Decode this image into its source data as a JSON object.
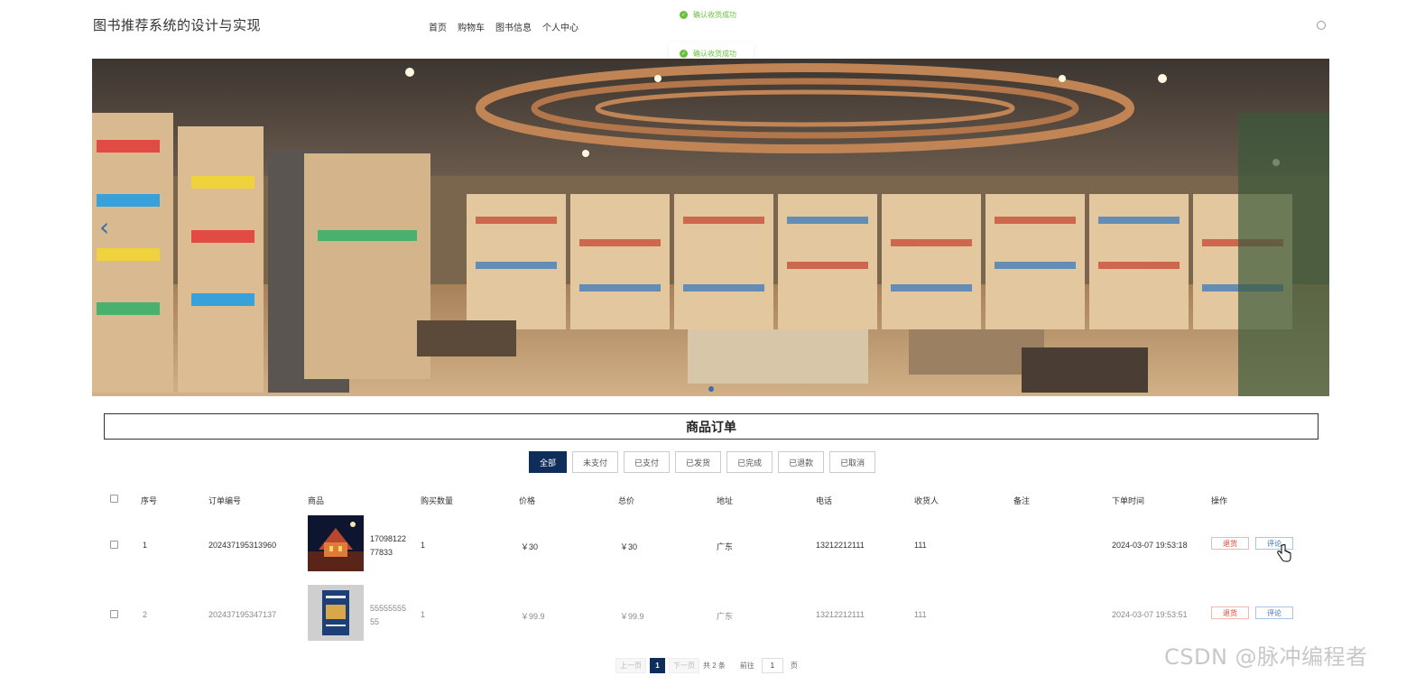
{
  "header": {
    "site_title": "图书推荐系统的设计与实现",
    "nav": [
      "首页",
      "购物车",
      "图书信息",
      "个人中心"
    ]
  },
  "toasts": [
    "确认收货成功",
    "确认收货成功"
  ],
  "section": {
    "title": "商品订单"
  },
  "filters": {
    "tabs": [
      "全部",
      "未支付",
      "已支付",
      "已发货",
      "已完成",
      "已退款",
      "已取消"
    ],
    "active": "全部"
  },
  "table": {
    "columns": [
      "序号",
      "订单编号",
      "商品",
      "购买数量",
      "价格",
      "总价",
      "地址",
      "电话",
      "收货人",
      "备注",
      "下单时间",
      "操作"
    ],
    "rows": [
      {
        "index": "1",
        "order_no": "202437195313960",
        "goods_id_line1": "17098122",
        "goods_id_line2": "77833",
        "qty": "1",
        "price": "￥30",
        "total": "￥30",
        "address": "广东",
        "phone": "13212212111",
        "receiver": "111",
        "note": "",
        "time": "2024-03-07 19:53:18",
        "actions": [
          "退货",
          "评论"
        ]
      },
      {
        "index": "2",
        "order_no": "202437195347137",
        "goods_id_line1": "55555555",
        "goods_id_line2": "55",
        "qty": "1",
        "price": "￥99.9",
        "total": "￥99.9",
        "address": "广东",
        "phone": "13212212111",
        "receiver": "111",
        "note": "",
        "time": "2024-03-07 19:53:51",
        "actions": [
          "退货",
          "评论"
        ]
      }
    ]
  },
  "pager": {
    "prev": "上一页",
    "current": "1",
    "next": "下一页",
    "total": "共 2 条",
    "goto_prefix": "前往",
    "goto_value": "1",
    "goto_suffix": "页"
  },
  "watermark": "CSDN @脉冲编程者",
  "colors": {
    "primary": "#0f2d5a",
    "success": "#67c23a",
    "danger": "#e0442e",
    "link": "#3a6fb0"
  }
}
